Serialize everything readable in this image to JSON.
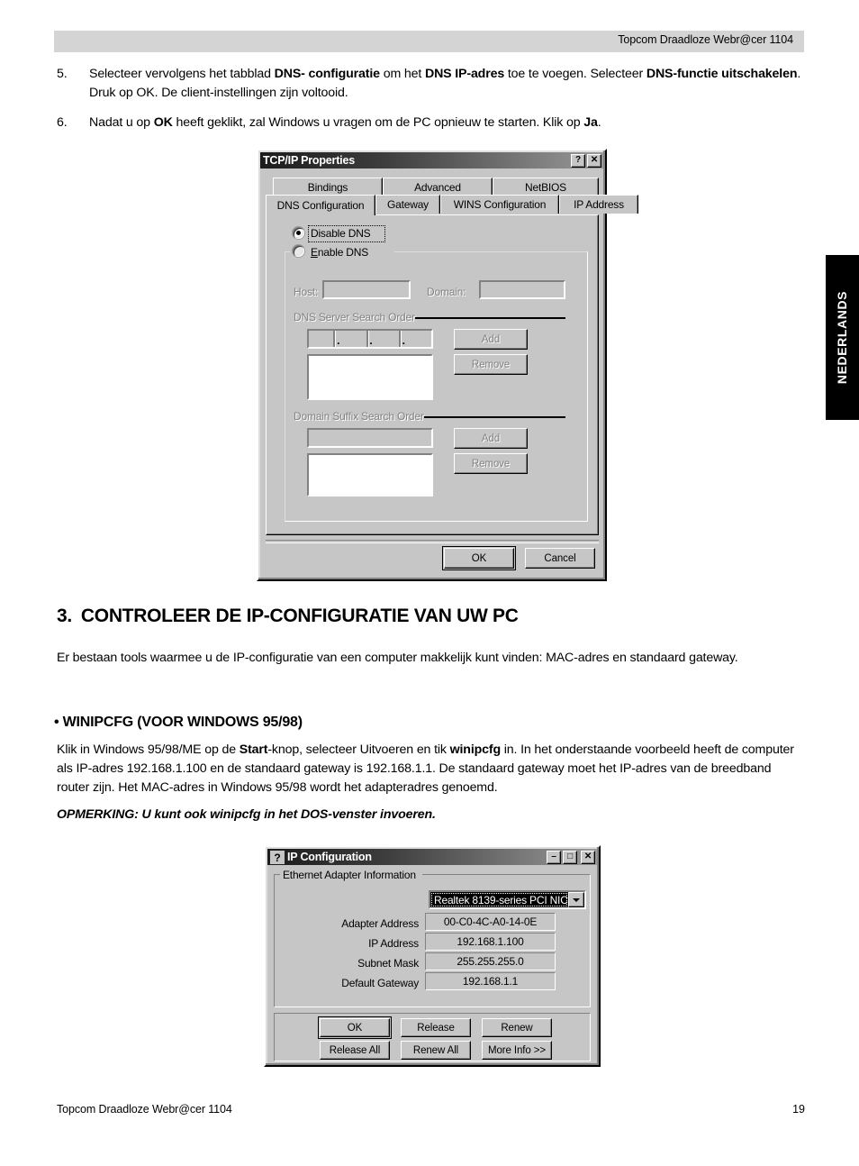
{
  "header": {
    "title": "Topcom Draadloze Webr@cer 1104"
  },
  "steps": [
    {
      "num": "5.",
      "parts": [
        {
          "t": "Selecteer vervolgens  het tabblad ",
          "b": false
        },
        {
          "t": "DNS- configuratie",
          "b": true
        },
        {
          "t": " om het ",
          "b": false
        },
        {
          "t": "DNS IP-adres",
          "b": true
        },
        {
          "t": " toe te voegen. Selecteer ",
          "b": false
        },
        {
          "t": "DNS-functie uitschakelen",
          "b": true
        },
        {
          "t": ". Druk op OK. De client-instellingen zijn voltooid.",
          "b": false
        }
      ]
    },
    {
      "num": "6.",
      "parts": [
        {
          "t": "Nadat u op ",
          "b": false
        },
        {
          "t": "OK",
          "b": true
        },
        {
          "t": " heeft geklikt, zal Windows u vragen om de PC opnieuw te starten. Klik op ",
          "b": false
        },
        {
          "t": "Ja",
          "b": true
        },
        {
          "t": ".",
          "b": false
        }
      ]
    }
  ],
  "language_tab": {
    "label": "NEDERLANDS"
  },
  "tcpip_dialog": {
    "title": "TCP/IP Properties",
    "help_button": "?",
    "close_button": "✕",
    "tabs_row1": [
      "Bindings",
      "Advanced",
      "NetBIOS"
    ],
    "tabs_row2": [
      "DNS Configuration",
      "Gateway",
      "WINS Configuration",
      "IP Address"
    ],
    "active_tab": "DNS Configuration",
    "radio_disable": "Disable DNS",
    "radio_enable": "Enable DNS",
    "selected_radio": "Disable DNS",
    "host_label": "Host:",
    "host_value": "",
    "domain_label": "Domain:",
    "domain_value": "",
    "dns_group_label": "DNS Server Search Order",
    "dns_ip_octets": [
      "",
      "",
      "",
      ""
    ],
    "dns_ip_sep": ".",
    "dns_list_items": [],
    "dns_add_button": "Add",
    "dns_remove_button": "Remove",
    "suffix_group_label": "Domain Suffix Search Order",
    "suffix_input_value": "",
    "suffix_list_items": [],
    "suffix_add_button": "Add",
    "suffix_remove_button": "Remove",
    "ok_button": "OK",
    "cancel_button": "Cancel"
  },
  "section": {
    "number": "3.",
    "heading": "CONTROLEER DE IP-CONFIGURATIE VAN UW PC",
    "intro": "Er bestaan tools waarmee u de IP-configuratie van een computer makkelijk kunt vinden: MAC-adres en standaard gateway.",
    "subheading": "• WINIPCFG (VOOR WINDOWS 95/98)",
    "body_parts": [
      {
        "t": "Klik in Windows 95/98/ME op de ",
        "b": false
      },
      {
        "t": "Start",
        "b": true
      },
      {
        "t": "-knop, selecteer Uitvoeren en tik ",
        "b": false
      },
      {
        "t": "winipcfg",
        "b": true
      },
      {
        "t": " in. In het onderstaande voorbeeld heeft de computer als IP-adres 192.168.1.100 en de standaard gateway is 192.168.1.1. De standaard gateway moet het IP-adres van de breedband router zijn. Het MAC-adres in Windows 95/98 wordt het adapteradres genoemd.",
        "b": false
      }
    ],
    "note": "OPMERKING: U kunt ook winipcfg in het DOS-venster invoeren."
  },
  "ipconfig_dialog": {
    "title": "IP Configuration",
    "icon": "question-mark-icon",
    "minimize_button": "–",
    "maximize_button": "□",
    "close_button": "✕",
    "group_label": "Ethernet  Adapter Information",
    "adapter_selected": "Realtek 8139-series PCI NIC",
    "fields": [
      {
        "label": "Adapter Address",
        "value": "00-C0-4C-A0-14-0E"
      },
      {
        "label": "IP Address",
        "value": "192.168.1.100"
      },
      {
        "label": "Subnet Mask",
        "value": "255.255.255.0"
      },
      {
        "label": "Default Gateway",
        "value": "192.168.1.1"
      }
    ],
    "buttons_row1": [
      "OK",
      "Release",
      "Renew"
    ],
    "buttons_row2": [
      "Release All",
      "Renew All",
      "More Info >>"
    ]
  },
  "footer": {
    "left": "Topcom Draadloze Webr@cer 1104",
    "page": "19"
  },
  "colors": {
    "header_bar": "#d4d4d4",
    "dialog_face": "#c6c6c6",
    "tab_black": "#000000",
    "titlebar_dark": "#1c1c1c"
  }
}
